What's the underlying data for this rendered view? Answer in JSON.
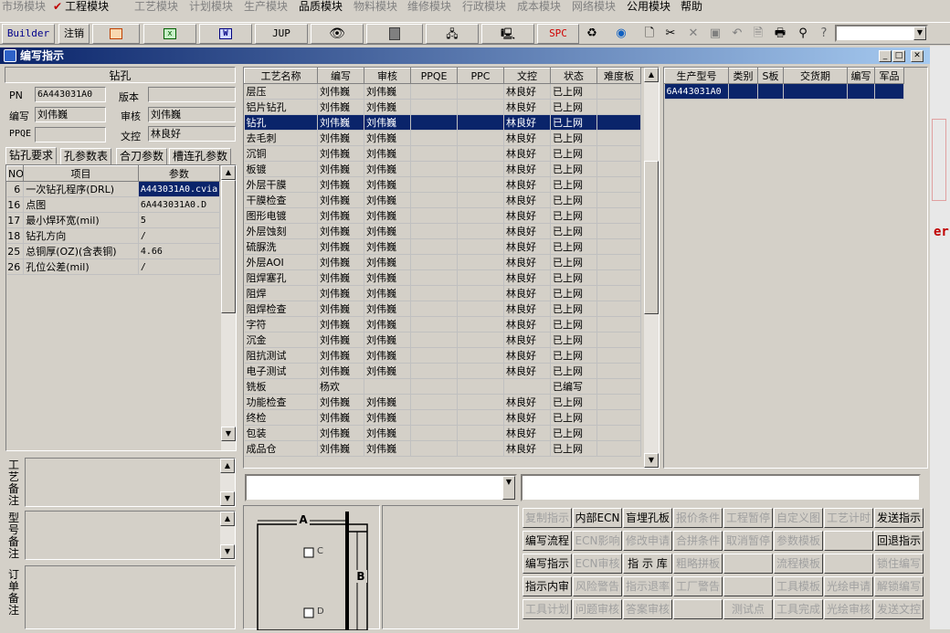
{
  "menu": [
    {
      "label": "市场模块",
      "enabled": false
    },
    {
      "label": "工程模块",
      "enabled": true,
      "checked": true
    },
    {
      "label": "工艺模块",
      "enabled": false
    },
    {
      "label": "计划模块",
      "enabled": false
    },
    {
      "label": "生产模块",
      "enabled": false
    },
    {
      "label": "品质模块",
      "enabled": true
    },
    {
      "label": "物料模块",
      "enabled": false
    },
    {
      "label": "维修模块",
      "enabled": false
    },
    {
      "label": "行政模块",
      "enabled": false
    },
    {
      "label": "成本模块",
      "enabled": false
    },
    {
      "label": "网络模块",
      "enabled": false
    },
    {
      "label": "公用模块",
      "enabled": true
    },
    {
      "label": "帮助",
      "enabled": true
    }
  ],
  "toolbar": {
    "builder": "Builder",
    "logout": "注销",
    "jup": "JUP",
    "spc": "SPC"
  },
  "window": {
    "title": "编写指示"
  },
  "left": {
    "process_title": "钻孔",
    "pn_label": "PN",
    "pn": "6A443031A0",
    "version_label": "版本",
    "version": "",
    "writer_label": "编写",
    "writer": "刘伟巍",
    "reviewer_label": "审核",
    "reviewer": "刘伟巍",
    "ppqe_label": "PPQE",
    "ppqe": "",
    "doc_label": "文控",
    "doc": "林良好",
    "tabs": [
      "钻孔要求",
      "孔参数表",
      "合刀参数",
      "槽连孔参数"
    ],
    "params_headers": [
      "NO",
      "项目",
      "参数"
    ],
    "params": [
      {
        "no": "6",
        "item": "一次钻孔程序(DRL)",
        "value": "A443031A0.cvia",
        "sel": true
      },
      {
        "no": "16",
        "item": "点图",
        "value": "6A443031A0.D"
      },
      {
        "no": "17",
        "item": "最小焊环宽(mil)",
        "value": "5"
      },
      {
        "no": "18",
        "item": "钻孔方向",
        "value": "/"
      },
      {
        "no": "25",
        "item": "总铜厚(OZ)(含表铜)",
        "value": "4.66"
      },
      {
        "no": "26",
        "item": "孔位公差(mil)",
        "value": "/"
      }
    ],
    "memo1_label": "工艺备注",
    "memo2_label": "型号备注",
    "memo3_label": "订单备注"
  },
  "process_grid": {
    "headers": [
      "工艺名称",
      "编写",
      "审核",
      "PPQE",
      "PPC",
      "文控",
      "状态",
      "难度板"
    ],
    "rows": [
      [
        "层压",
        "刘伟巍",
        "刘伟巍",
        "",
        "",
        "林良好",
        "已上网",
        ""
      ],
      [
        "铝片钻孔",
        "刘伟巍",
        "刘伟巍",
        "",
        "",
        "林良好",
        "已上网",
        ""
      ],
      [
        "钻孔",
        "刘伟巍",
        "刘伟巍",
        "",
        "",
        "林良好",
        "已上网",
        ""
      ],
      [
        "去毛刺",
        "刘伟巍",
        "刘伟巍",
        "",
        "",
        "林良好",
        "已上网",
        ""
      ],
      [
        "沉铜",
        "刘伟巍",
        "刘伟巍",
        "",
        "",
        "林良好",
        "已上网",
        ""
      ],
      [
        "板镀",
        "刘伟巍",
        "刘伟巍",
        "",
        "",
        "林良好",
        "已上网",
        ""
      ],
      [
        "外层干膜",
        "刘伟巍",
        "刘伟巍",
        "",
        "",
        "林良好",
        "已上网",
        ""
      ],
      [
        "干膜检查",
        "刘伟巍",
        "刘伟巍",
        "",
        "",
        "林良好",
        "已上网",
        ""
      ],
      [
        "图形电镀",
        "刘伟巍",
        "刘伟巍",
        "",
        "",
        "林良好",
        "已上网",
        ""
      ],
      [
        "外层蚀刻",
        "刘伟巍",
        "刘伟巍",
        "",
        "",
        "林良好",
        "已上网",
        ""
      ],
      [
        "硫脲洗",
        "刘伟巍",
        "刘伟巍",
        "",
        "",
        "林良好",
        "已上网",
        ""
      ],
      [
        "外层AOI",
        "刘伟巍",
        "刘伟巍",
        "",
        "",
        "林良好",
        "已上网",
        ""
      ],
      [
        "阻焊塞孔",
        "刘伟巍",
        "刘伟巍",
        "",
        "",
        "林良好",
        "已上网",
        ""
      ],
      [
        "阻焊",
        "刘伟巍",
        "刘伟巍",
        "",
        "",
        "林良好",
        "已上网",
        ""
      ],
      [
        "阻焊检查",
        "刘伟巍",
        "刘伟巍",
        "",
        "",
        "林良好",
        "已上网",
        ""
      ],
      [
        "字符",
        "刘伟巍",
        "刘伟巍",
        "",
        "",
        "林良好",
        "已上网",
        ""
      ],
      [
        "沉金",
        "刘伟巍",
        "刘伟巍",
        "",
        "",
        "林良好",
        "已上网",
        ""
      ],
      [
        "阻抗测试",
        "刘伟巍",
        "刘伟巍",
        "",
        "",
        "林良好",
        "已上网",
        ""
      ],
      [
        "电子测试",
        "刘伟巍",
        "刘伟巍",
        "",
        "",
        "林良好",
        "已上网",
        ""
      ],
      [
        "铣板",
        "杨欢",
        "",
        "",
        "",
        "",
        "已编写",
        ""
      ],
      [
        "功能检查",
        "刘伟巍",
        "刘伟巍",
        "",
        "",
        "林良好",
        "已上网",
        ""
      ],
      [
        "终检",
        "刘伟巍",
        "刘伟巍",
        "",
        "",
        "林良好",
        "已上网",
        ""
      ],
      [
        "包装",
        "刘伟巍",
        "刘伟巍",
        "",
        "",
        "林良好",
        "已上网",
        ""
      ],
      [
        "成品仓",
        "刘伟巍",
        "刘伟巍",
        "",
        "",
        "林良好",
        "已上网",
        ""
      ]
    ],
    "selected_row": 2
  },
  "model_grid": {
    "headers": [
      "生产型号",
      "类别",
      "S板",
      "交货期",
      "编写",
      "军品"
    ],
    "rows": [
      [
        "6A443031A0",
        "",
        "",
        "",
        "",
        ""
      ]
    ]
  },
  "diagram": {
    "a": "A",
    "b": "B",
    "c": "C",
    "d": "D"
  },
  "buttons": [
    [
      {
        "l": "复制指示",
        "e": false
      },
      {
        "l": "内部ECN",
        "e": true
      },
      {
        "l": "盲埋孔板",
        "e": true
      },
      {
        "l": "报价条件",
        "e": false
      },
      {
        "l": "工程暂停",
        "e": false
      },
      {
        "l": "自定义图",
        "e": false
      },
      {
        "l": "工艺计时",
        "e": false
      },
      {
        "l": "发送指示",
        "e": true
      }
    ],
    [
      {
        "l": "编写流程",
        "e": true
      },
      {
        "l": "ECN影响",
        "e": false
      },
      {
        "l": "修改申请",
        "e": false
      },
      {
        "l": "合拼条件",
        "e": false
      },
      {
        "l": "取消暂停",
        "e": false
      },
      {
        "l": "参数模板",
        "e": false
      },
      {
        "l": "",
        "e": false
      },
      {
        "l": "回退指示",
        "e": true
      }
    ],
    [
      {
        "l": "编写指示",
        "e": true
      },
      {
        "l": "ECN审核",
        "e": false
      },
      {
        "l": "指 示 库",
        "e": true
      },
      {
        "l": "粗略拼板",
        "e": false
      },
      {
        "l": "",
        "e": false
      },
      {
        "l": "流程模板",
        "e": false
      },
      {
        "l": "",
        "e": false
      },
      {
        "l": "锁住编写",
        "e": false
      }
    ],
    [
      {
        "l": "指示内审",
        "e": true
      },
      {
        "l": "风险警告",
        "e": false
      },
      {
        "l": "指示退率",
        "e": false
      },
      {
        "l": "工厂警告",
        "e": false
      },
      {
        "l": "",
        "e": false
      },
      {
        "l": "工具模板",
        "e": false
      },
      {
        "l": "光绘申请",
        "e": false
      },
      {
        "l": "解锁编写",
        "e": false
      }
    ],
    [
      {
        "l": "工具计划",
        "e": false
      },
      {
        "l": "问题审核",
        "e": false
      },
      {
        "l": "答案审核",
        "e": false
      },
      {
        "l": "",
        "e": false
      },
      {
        "l": "测试点",
        "e": false
      },
      {
        "l": "工具完成",
        "e": false
      },
      {
        "l": "光绘审核",
        "e": false
      },
      {
        "l": "发送文控",
        "e": false
      }
    ]
  ]
}
